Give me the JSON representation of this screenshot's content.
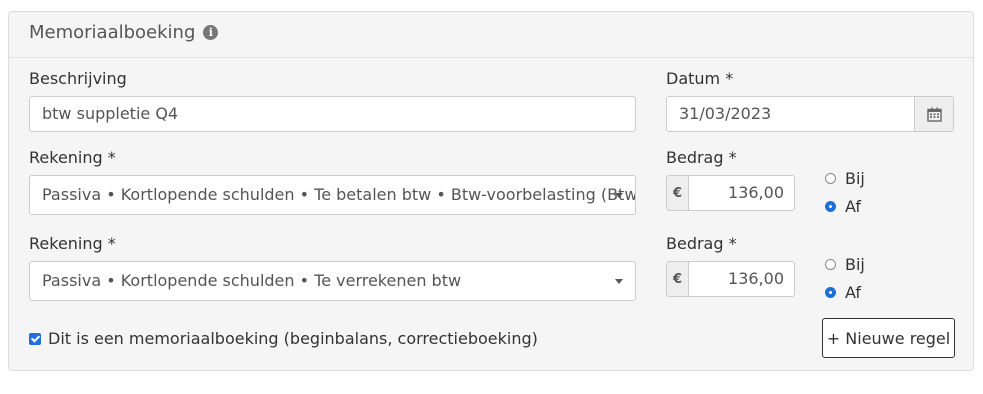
{
  "panel": {
    "title": "Memoriaalboeking"
  },
  "fields": {
    "description": {
      "label": "Beschrijving",
      "value": "btw suppletie Q4"
    },
    "date": {
      "label": "Datum *",
      "value": "31/03/2023"
    }
  },
  "lines": [
    {
      "account_label": "Rekening *",
      "account_value": "Passiva • Kortlopende schulden • Te betalen btw • Btw-voorbelasting (Btw-categorie)",
      "amount_label": "Bedrag *",
      "currency": "€",
      "amount": "136,00",
      "options": [
        "Bij",
        "Af"
      ],
      "selected": "Af"
    },
    {
      "account_label": "Rekening *",
      "account_value": "Passiva • Kortlopende schulden • Te verrekenen btw",
      "amount_label": "Bedrag *",
      "currency": "€",
      "amount": "136,00",
      "options": [
        "Bij",
        "Af"
      ],
      "selected": "Af"
    }
  ],
  "checkbox": {
    "label": "Dit is een memoriaalboeking (beginbalans, correctieboeking)",
    "checked": true
  },
  "add_button": "+ Nieuwe regel",
  "icons": {
    "info": "info-icon",
    "calendar": "calendar-icon",
    "caret": "chevron-down-icon"
  },
  "colors": {
    "accent": "#1e6fd9",
    "panel_bg": "#f5f5f5"
  }
}
